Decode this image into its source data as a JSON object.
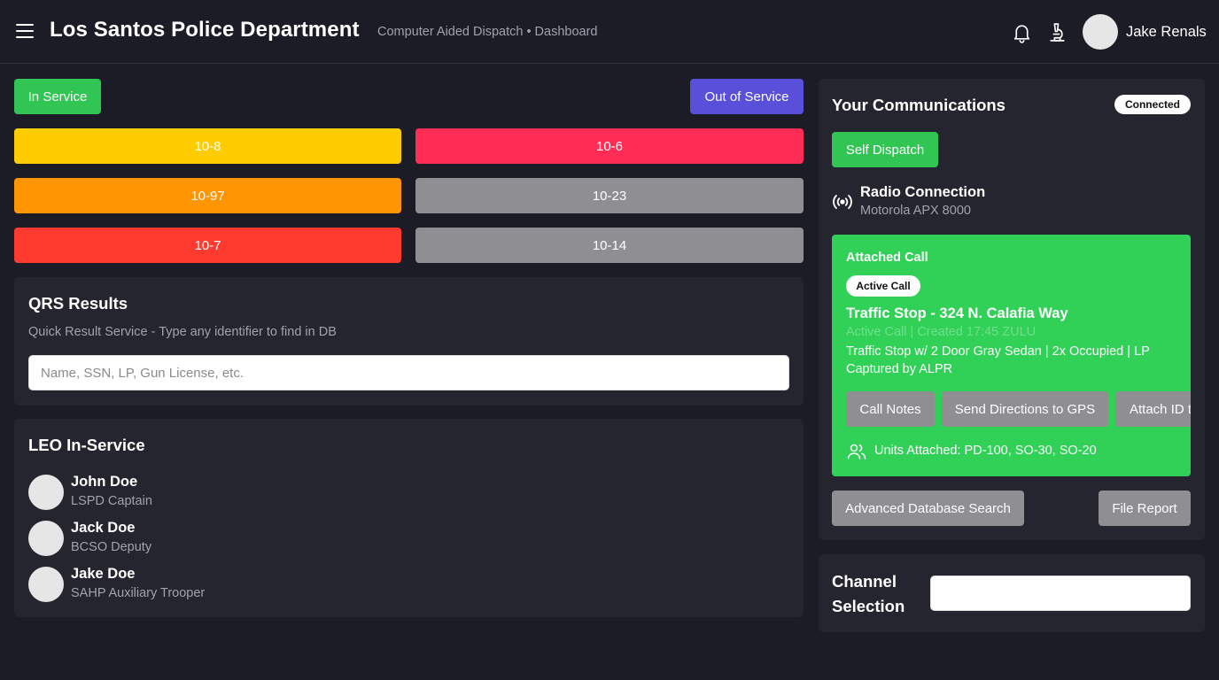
{
  "header": {
    "title": "Los Santos Police Department",
    "subtitle": "Computer Aided Dispatch • Dashboard",
    "user_name": "Jake Renals",
    "icons": [
      "menu-icon",
      "bell-icon",
      "microscope-icon"
    ]
  },
  "status": {
    "in_service": "In Service",
    "out_of_service": "Out of Service",
    "codes": [
      "10-8",
      "10-6",
      "10-97",
      "10-23",
      "10-7",
      "10-14"
    ]
  },
  "qrs": {
    "title": "QRS Results",
    "description": "Quick Result Service - Type any identifier to find in DB",
    "placeholder": "Name, SSN, LP, Gun License, etc."
  },
  "leo": {
    "title": "LEO In-Service",
    "officers": [
      {
        "name": "John Doe",
        "role": "LSPD Captain"
      },
      {
        "name": "Jack Doe",
        "role": "BCSO Deputy"
      },
      {
        "name": "Jake Doe",
        "role": "SAHP Auxiliary Trooper"
      }
    ]
  },
  "comms": {
    "title": "Your Communications",
    "connection_badge": "Connected",
    "self_dispatch": "Self Dispatch",
    "radio_label": "Radio Connection",
    "radio_model": "Motorola APX 8000",
    "attached_call": {
      "label": "Attached Call",
      "badge": "Active Call",
      "title": "Traffic Stop - 324 N. Calafia Way",
      "meta": "Active Call | Created 17:45 ZULU",
      "description": "Traffic Stop w/ 2 Door Gray Sedan | 2x Occupied | LP Captured by ALPR",
      "buttons": [
        "Call Notes",
        "Send Directions to GPS",
        "Attach ID to Call"
      ],
      "units": "Units Attached: PD-100, SO-30, SO-20"
    },
    "advanced_search": "Advanced Database Search",
    "file_report": "File Report"
  },
  "channel": {
    "label_line1": "Channel",
    "label_line2": "Selection",
    "value": ""
  },
  "colors": {
    "background": "#1c1c27",
    "panel": "#25252f",
    "green": "#31c553",
    "purple": "#5a4fdb",
    "yellow": "#ffcc00",
    "pink": "#ff2d55",
    "orange": "#ff9500",
    "red": "#ff3b30",
    "grey": "#8e8e93"
  }
}
